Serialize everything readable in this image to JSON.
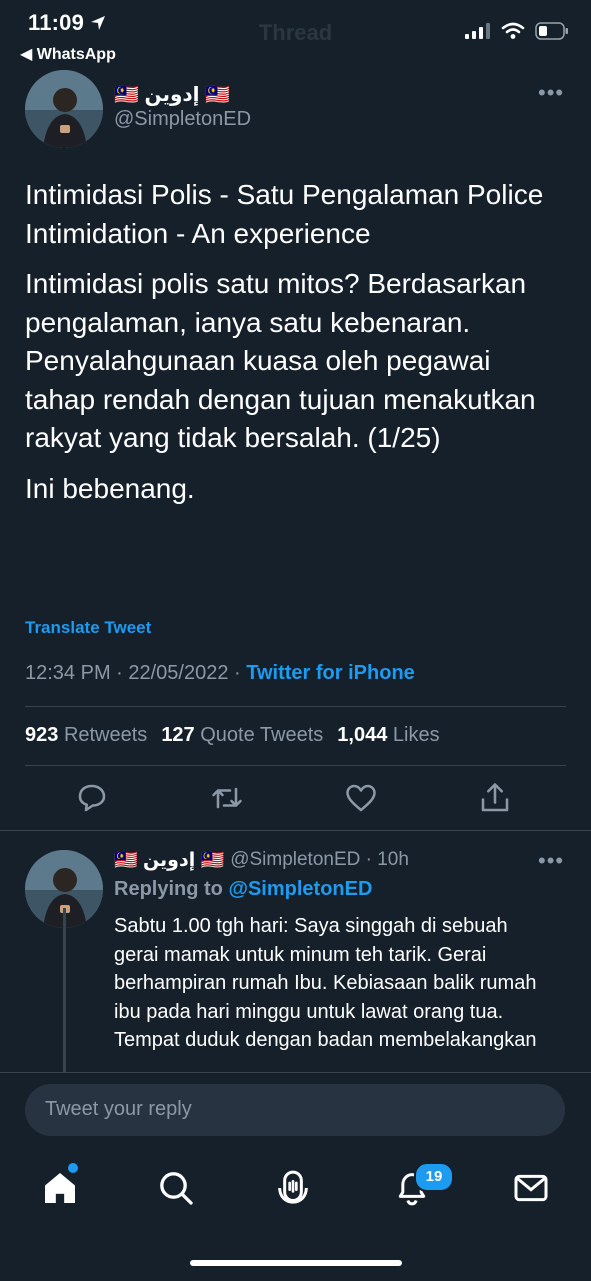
{
  "status_bar": {
    "time": "11:09",
    "back_label": "◀ WhatsApp"
  },
  "header": {
    "title": "Thread"
  },
  "tweet": {
    "author_name": "🇲🇾 إدوين 🇲🇾",
    "handle": "@SimpletonED",
    "paragraphs": [
      "Intimidasi Polis - Satu Pengalaman Police Intimidation - An experience",
      "Intimidasi polis satu mitos? Berdasarkan pengalaman, ianya satu kebenaran. Penyalahgunaan kuasa oleh pegawai tahap rendah dengan tujuan menakutkan rakyat yang tidak bersalah. (1/25)",
      "Ini bebenang."
    ],
    "translate_label": "Translate Tweet",
    "timestamp": "12:34 PM · 22/05/2022 ·",
    "source": "Twitter for iPhone",
    "stats": {
      "retweets_count": "923",
      "retweets_label": "Retweets",
      "quotes_count": "127",
      "quotes_label": "Quote Tweets",
      "likes_count": "1,044",
      "likes_label": "Likes"
    }
  },
  "reply": {
    "author_name": "🇲🇾 إدوين 🇲🇾",
    "handle_time": "@SimpletonED · 10h",
    "replying_prefix": "Replying to",
    "replying_handle": "@SimpletonED",
    "text": "Sabtu 1.00 tgh hari: Saya singgah di sebuah gerai mamak untuk minum teh tarik. Gerai berhampiran rumah Ibu. Kebiasaan balik rumah ibu pada hari minggu untuk lawat orang tua. Tempat duduk dengan badan membelakangkan"
  },
  "composer": {
    "placeholder": "Tweet your reply"
  },
  "tabbar": {
    "notification_count": "19"
  },
  "icons": {
    "back": "back-arrow-icon",
    "more": "more-dots-icon",
    "reply": "reply-icon",
    "retweet": "retweet-icon",
    "like": "heart-icon",
    "share": "share-icon",
    "home": "home-icon",
    "search": "search-icon",
    "spaces": "spaces-icon",
    "notifications": "bell-icon",
    "messages": "mail-icon"
  },
  "colors": {
    "background": "#15202b",
    "accent": "#1d9bf0",
    "muted": "#8b98a5",
    "divider": "#38444d"
  }
}
